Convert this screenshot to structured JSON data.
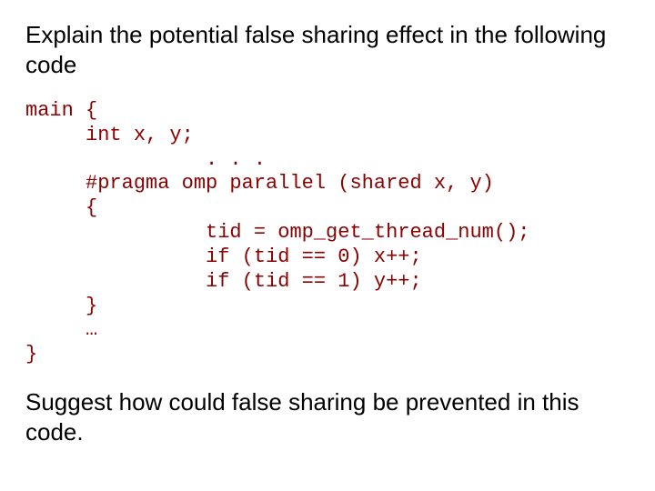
{
  "prompt": "Explain the potential false sharing effect in the following code",
  "code": {
    "l1": "main {",
    "l2": "     int x, y;",
    "l3": "               . . .",
    "l4": "     #pragma omp parallel (shared x, y)",
    "l5": "     {",
    "l6": "               tid = omp_get_thread_num();",
    "l7": "               if (tid == 0) x++;",
    "l8": "               if (tid == 1) y++;",
    "l9": "     }",
    "l10": "     …",
    "l11": "}"
  },
  "question": "Suggest how could false sharing be prevented in this code."
}
